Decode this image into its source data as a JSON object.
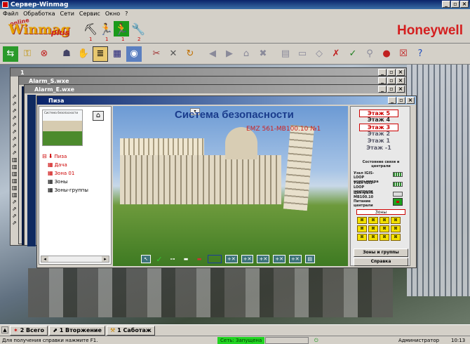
{
  "app": {
    "title": "Сервер-Winmag",
    "menu": [
      "Файл",
      "Обработка",
      "Сети",
      "Сервис",
      "Окно",
      "?"
    ]
  },
  "brand": {
    "logo": "Winmag",
    "logo_plus": "plus",
    "logo_online": "online",
    "honeywell": "Honeywell",
    "tool_counts": [
      "1",
      "1",
      "1",
      "2"
    ]
  },
  "toolbar": {
    "icons": [
      "exit-icon",
      "key-icon",
      "cancel-icon",
      "users-icon",
      "hand-icon",
      "list-icon",
      "grid-icon",
      "camera-icon",
      "tools-icon",
      "wrench-icon",
      "refresh-icon",
      "back-icon",
      "forward-icon",
      "folder-icon",
      "delete-icon",
      "table-icon",
      "card-icon",
      "tag-icon",
      "tag-x-icon",
      "tag-check-icon",
      "search-icon",
      "traffic-light-icon",
      "close-red-icon",
      "help-icon"
    ]
  },
  "windows": {
    "back1": "1",
    "back2": "Alarm_S.wxe",
    "back3": "Alarm_E.wxe",
    "pisa": "Пиза"
  },
  "tree": [
    {
      "label": "Пиза",
      "red": true
    },
    {
      "label": "Дача",
      "red": true
    },
    {
      "label": "Зона 01",
      "red": true
    },
    {
      "label": "Зоны",
      "red": false
    },
    {
      "label": "Зоны-группы",
      "red": false
    }
  ],
  "photo": {
    "title": "Система безопасности",
    "subtitle": "EMZ 561-MB100.10 №1"
  },
  "floors": [
    "Этаж 5",
    "Этаж 4",
    "Этаж 3",
    "Этаж 2",
    "Этаж 1",
    "Этаж -1"
  ],
  "right": {
    "status_title": "Состояние связи и централи",
    "node1": "Узел IGIS-LOOP компьютера",
    "node2": "Узел IGIS-LOOP централи",
    "central": "Централь MB100.10",
    "central_pv": "Питание централи",
    "zones": "Зоны",
    "btn_groups": "Зоны и группы",
    "btn_help": "Справка"
  },
  "tabs": [
    {
      "label": "2 Всего",
      "icon": "alarm-icon"
    },
    {
      "label": "1 Вторжение",
      "icon": "intrusion-icon"
    },
    {
      "label": "1 Саботаж",
      "icon": "sabotage-icon"
    }
  ],
  "status": {
    "help": "Для получения справки нажмите F1.",
    "net": "Сеть: Запущена",
    "user": "Администратор",
    "time": "10:13"
  }
}
